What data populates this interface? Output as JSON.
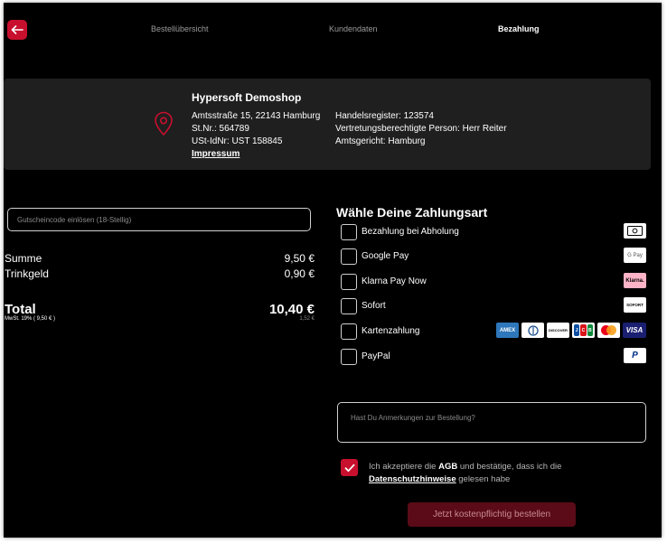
{
  "header": {
    "steps": [
      "Bestellübersicht",
      "Kundendaten",
      "Bezahlung"
    ],
    "active_step": "Bezahlung"
  },
  "shop": {
    "name": "Hypersoft Demoshop",
    "address": "Amtsstraße 15, 22143 Hamburg",
    "tax_number": "St.Nr.: 564789",
    "vat_id": "USt-IdNr: UST 158845",
    "impressum": "Impressum",
    "register": "Handelsregister: 123574",
    "representative": "Vertretungsberechtigte Person: Herr Reiter",
    "court": "Amtsgericht: Hamburg"
  },
  "voucher": {
    "placeholder": "Gutscheincode einlösen (18-Stellig)"
  },
  "totals": {
    "sum_label": "Summe",
    "sum_value": "9,50 €",
    "tip_label": "Trinkgeld",
    "tip_value": "0,90 €",
    "total_label": "Total",
    "total_value": "10,40 €",
    "vat_label": "MwSt. 19% ( 9,50 € )",
    "vat_value": "1,52 €"
  },
  "payment": {
    "title": "Wähle Deine Zahlungsart",
    "methods": [
      {
        "label": "Bezahlung bei Abholung",
        "icons": [
          "cash-icon"
        ]
      },
      {
        "label": "Google Pay",
        "icons": [
          "google-pay-logo"
        ],
        "logo_text": "G Pay"
      },
      {
        "label": "Klarna Pay Now",
        "icons": [
          "klarna-logo"
        ],
        "logo_text": "Klarna."
      },
      {
        "label": "Sofort",
        "icons": [
          "sofort-logo"
        ],
        "logo_text": "SOFORT"
      },
      {
        "label": "Kartenzahlung",
        "icons": [
          "amex-logo",
          "diners-logo",
          "discover-logo",
          "jcb-logo",
          "mastercard-logo",
          "visa-logo"
        ],
        "logo_texts": {
          "amex": "AMEX",
          "discover": "DISCOVER",
          "jcb": [
            "J",
            "C",
            "B"
          ],
          "visa": "VISA"
        }
      },
      {
        "label": "PayPal",
        "icons": [
          "paypal-logo"
        ],
        "logo_text": "P"
      }
    ]
  },
  "notes": {
    "placeholder": "Hast Du Anmerkungen zur Bestellung?"
  },
  "agb": {
    "checked": true,
    "text_before": "Ich akzeptiere die ",
    "agb_link": "AGB",
    "text_middle": " und bestätige, dass ich die ",
    "privacy_link": "Datenschutzhinweise",
    "text_after": " gelesen habe"
  },
  "submit_label": "Jetzt kostenpflichtig bestellen",
  "colors": {
    "accent": "#c8102e",
    "background": "#000000",
    "panel": "#1f1f1f",
    "submit_bg": "#5a0b17"
  }
}
